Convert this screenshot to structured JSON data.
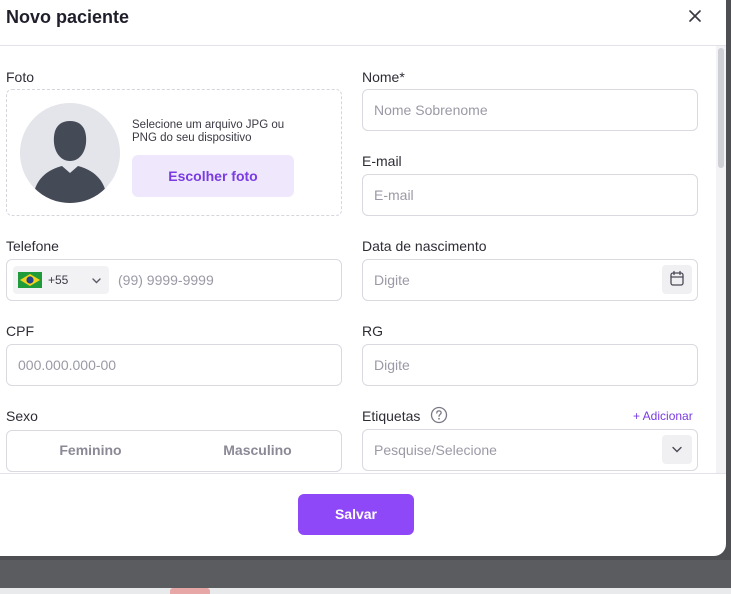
{
  "modal": {
    "title": "Novo paciente",
    "save_label": "Salvar"
  },
  "photo": {
    "label": "Foto",
    "hint": "Selecione um arquivo JPG ou PNG do seu dispositivo",
    "choose_label": "Escolher foto"
  },
  "fields": {
    "name": {
      "label": "Nome*",
      "placeholder": "Nome Sobrenome",
      "value": ""
    },
    "email": {
      "label": "E-mail",
      "placeholder": "E-mail",
      "value": ""
    },
    "phone": {
      "label": "Telefone",
      "country_code": "+55",
      "placeholder": "(99) 9999-9999",
      "value": ""
    },
    "birth": {
      "label": "Data de nascimento",
      "placeholder": "Digite",
      "value": ""
    },
    "cpf": {
      "label": "CPF",
      "placeholder": "000.000.000-00",
      "value": ""
    },
    "rg": {
      "label": "RG",
      "placeholder": "Digite",
      "value": ""
    }
  },
  "sex": {
    "label": "Sexo",
    "options": [
      "Feminino",
      "Masculino"
    ]
  },
  "tags": {
    "label": "Etiquetas",
    "add_label": "+ Adicionar",
    "placeholder": "Pesquise/Selecione"
  },
  "colors": {
    "accent": "#8f48f7",
    "accent_light": "#efe8fd",
    "border": "#d9d9e0"
  },
  "icons": {
    "close": "close-icon",
    "calendar": "calendar-icon",
    "chevron": "chevron-down-icon",
    "help": "question-circle-icon",
    "flag": "brazil-flag-icon",
    "avatar": "user-silhouette-icon"
  }
}
